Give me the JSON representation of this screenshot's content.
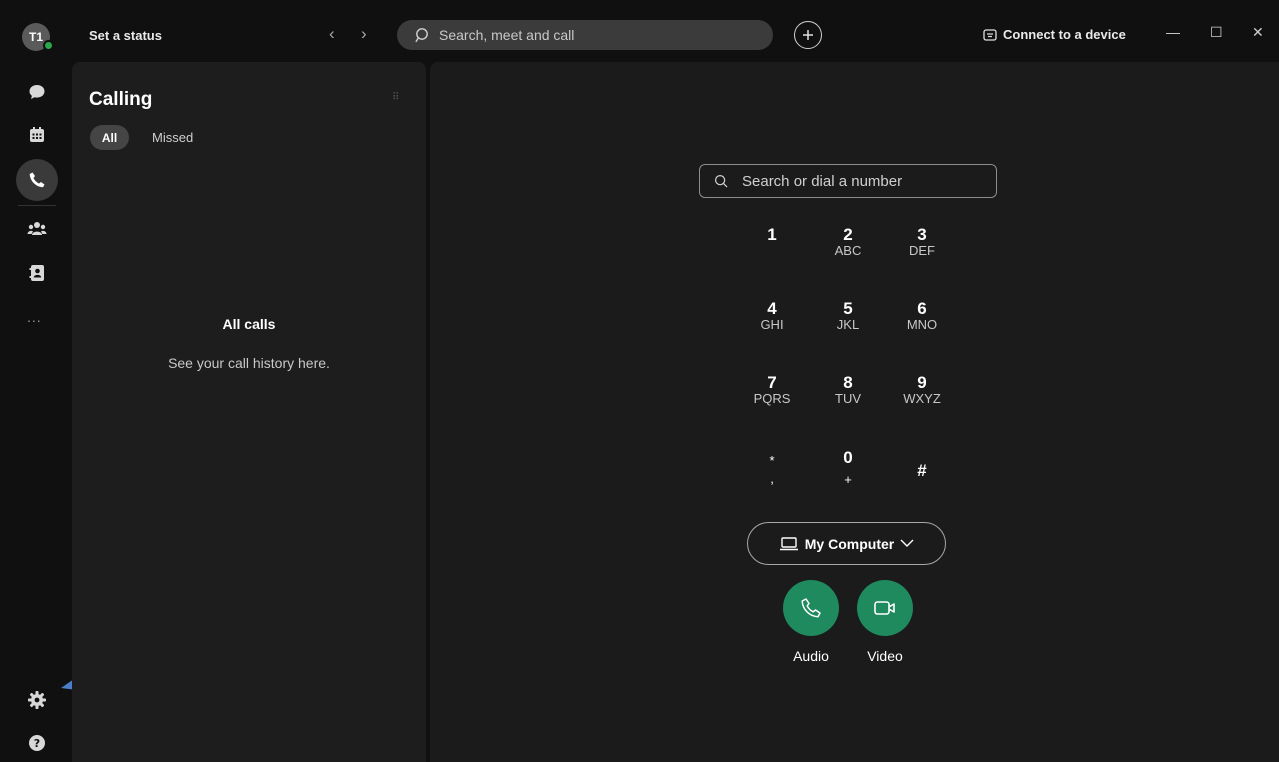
{
  "app": {
    "avatar_initials": "T1",
    "status_text": "Set a status",
    "search_placeholder": "Search, meet and call",
    "connect_label": "Connect to a device"
  },
  "window_controls": {
    "minimize": "—",
    "maximize": "☐",
    "close": "✕"
  },
  "nav": {
    "back": "‹",
    "forward": "›"
  },
  "rail": {
    "items": [
      "messaging-icon",
      "calendar-icon",
      "phone-icon",
      "teams-icon",
      "contacts-icon"
    ],
    "more": "...",
    "bottom": [
      "gear-icon",
      "help-icon"
    ]
  },
  "calling": {
    "title": "Calling",
    "tabs": {
      "all": "All",
      "missed": "Missed"
    },
    "empty_title": "All calls",
    "empty_subtitle": "See your call history here."
  },
  "dialpad": {
    "search_placeholder": "Search or dial a number",
    "keys": [
      {
        "digit": "1",
        "letters": ""
      },
      {
        "digit": "2",
        "letters": "ABC"
      },
      {
        "digit": "3",
        "letters": "DEF"
      },
      {
        "digit": "4",
        "letters": "GHI"
      },
      {
        "digit": "5",
        "letters": "JKL"
      },
      {
        "digit": "6",
        "letters": "MNO"
      },
      {
        "digit": "7",
        "letters": "PQRS"
      },
      {
        "digit": "8",
        "letters": "TUV"
      },
      {
        "digit": "9",
        "letters": "WXYZ"
      },
      {
        "digit": "*",
        "letters": ","
      },
      {
        "digit": "0",
        "letters": "+"
      },
      {
        "digit": "#",
        "letters": ""
      }
    ],
    "device": "My Computer",
    "audio_label": "Audio",
    "video_label": "Video"
  },
  "colors": {
    "accent_green": "#1f8a5e",
    "presence_green": "#2aa84a",
    "annotation_arrow": "#4a7ec8"
  }
}
